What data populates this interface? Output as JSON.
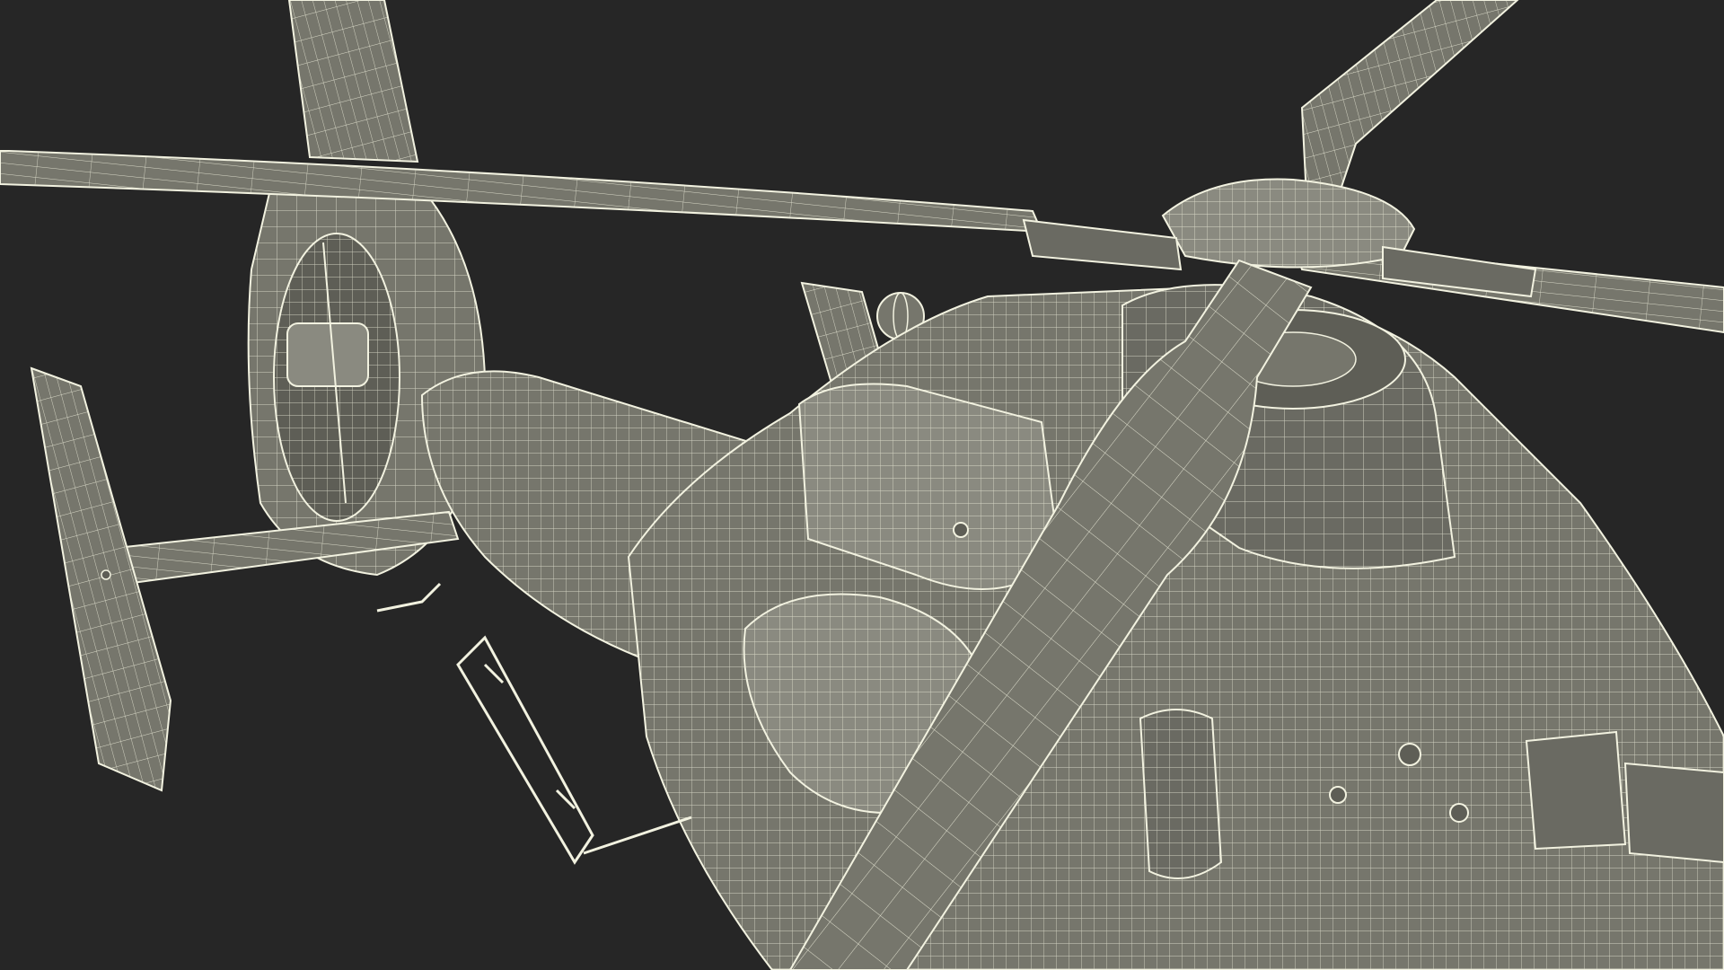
{
  "scene": {
    "subject": "helicopter-wireframe-render",
    "colors": {
      "background": "#262626",
      "surface": "#76766c",
      "surface_light": "#8a8a80",
      "surface_dark": "#5e5e56",
      "wire": "#f2f2e0"
    }
  }
}
